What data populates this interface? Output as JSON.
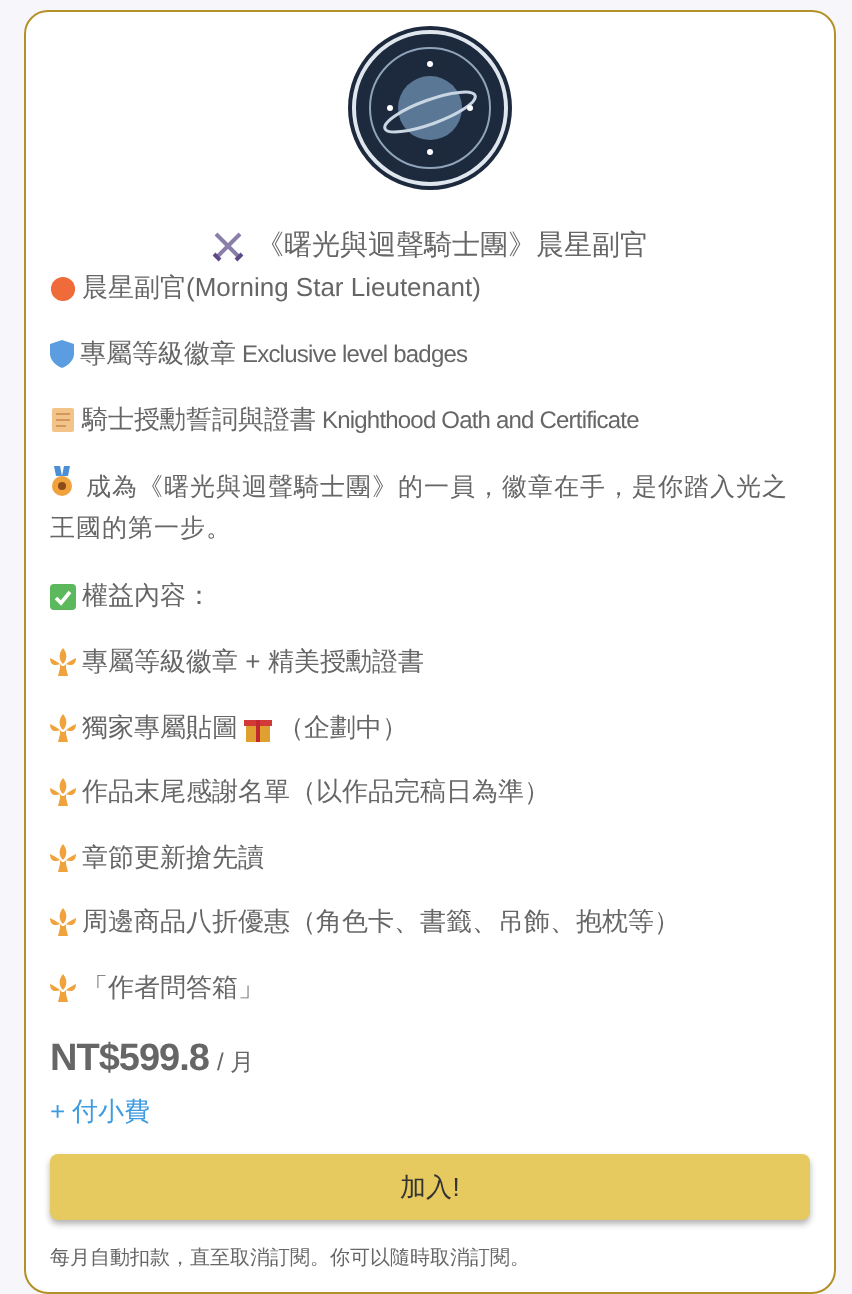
{
  "title": "《曙光與迴聲騎士團》晨星副官",
  "intro": [
    {
      "text": "晨星副官(Morning Star Lieutenant)"
    },
    {
      "text": "專屬等級徽章",
      "en": "Exclusive level badges"
    },
    {
      "text": "騎士授勳誓詞與證書",
      "en": "Knighthood Oath and Certificate"
    }
  ],
  "description": "成為《曙光與迴聲騎士團》的一員，徽章在手，是你踏入光之王國的第一步。",
  "benefits_heading": "權益內容：",
  "benefits": [
    {
      "text": "專屬等級徽章 + 精美授勳證書"
    },
    {
      "text": "獨家專屬貼圖",
      "gift": true,
      "after": "（企劃中）"
    },
    {
      "text": "作品末尾感謝名單（以作品完稿日為準）"
    },
    {
      "text": "章節更新搶先讀"
    },
    {
      "text": "周邊商品八折優惠（角色卡、書籤、吊飾、抱枕等）"
    },
    {
      "text": "「作者問答箱」"
    }
  ],
  "price": {
    "amount": "NT$599.8",
    "period": "/ 月"
  },
  "tip_link": "+ 付小費",
  "join_button": "加入!",
  "footnote": "每月自動扣款，直至取消訂閱。你可以隨時取消訂閱。"
}
